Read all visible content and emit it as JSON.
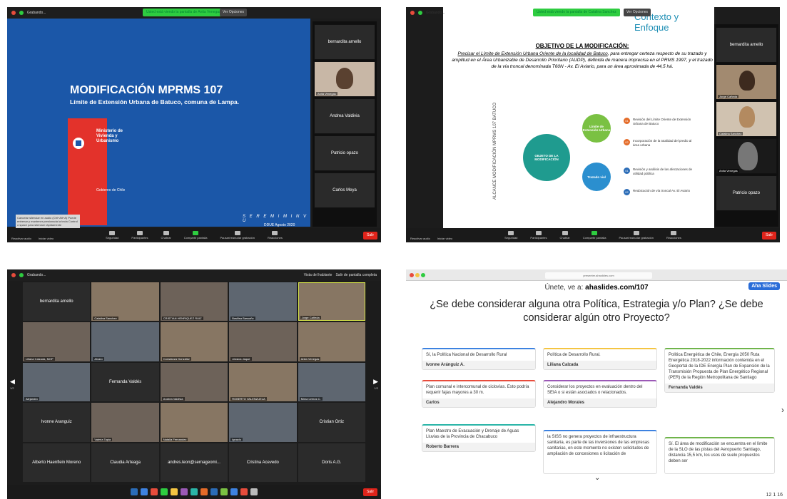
{
  "q1": {
    "recording": "Grabando...",
    "share_banner": "Usted está viendo la pantalla de Anita Venegas",
    "view_options": "Ver Opciones",
    "slide_title": "MODIFICACIÓN MPRMS 107",
    "slide_subtitle": "Límite de Extensión Urbana de Batuco, comuna de Lampa.",
    "ministry": "Ministerio de Vivienda y Urbanismo",
    "gobierno": "Gobierno de Chile",
    "seremi": "S E R E M I   M I N V U",
    "ddue": "DDUE Agosto 2020",
    "tooltip": "Cancelar silenciar en audio (Ctrl+Alt+A) Puede entrenar y mantener presionada la tecla Control o space para silenciar rápidamente",
    "participants": [
      "bernardita arnello",
      "Anita Venegas",
      "Andrea Valdivia",
      "Patricio opazo",
      "Carlos Meya"
    ],
    "url_tooltip": "https://asistente.ahaslides.com/",
    "bottom": [
      "Reactivar audio",
      "Iniciar video",
      "Seguridad",
      "Participantes",
      "Chatear",
      "Compartir pantalla",
      "Pausar/reanudar grabación",
      "Reacciones"
    ],
    "end": "Salir"
  },
  "q2": {
    "recording": "Grabando...",
    "share_banner": "Usted está viendo la pantalla de Catalina Sanchez",
    "view_options": "Ver Opciones",
    "ctx_title": "Contexto y Enfoque",
    "obj_heading": "OBJETIVO DE LA MODIFICACIÓN:",
    "obj_text_underlined": "Precisar el Límite de Extensión Urbana Oriente de la localidad de Batuco",
    "obj_text": ", para entregar certeza respecto de su trazado y amplitud en el Área Urbanizable de Desarrollo Prioritario (AUDP), definida de manera imprecisa en el PRMS 1997, y el trazado de la vía troncal denominada T60N - Av. El Aviario, para un área aproximada de 44,5 há.",
    "vertical_label": "ALCANCE MODIFICACIÓN MPRMS 107 BATUCO",
    "center": "OBJETO DE LA MODIFICACIÓN",
    "node_limit": "Límite de Extensión Urbana",
    "node_road": "Trazado vial",
    "items": [
      {
        "n": "01",
        "text": "Revisión del Límite Oriente de Extensión Urbana de Batuco"
      },
      {
        "n": "02",
        "text": "Incorporación de la totalidad del predio al área urbana"
      },
      {
        "n": "01",
        "text": "Revisión y análisis de las afectaciones de utilidad pública"
      },
      {
        "n": "02",
        "text": "Reubicación de vía troncal Av. El Aviario"
      }
    ],
    "participants": [
      "bernardita arnello",
      "Jorge Cañeda",
      "Catalina Sanchez",
      "Anita Venegas",
      "Patricio opazo"
    ],
    "end": "Salir"
  },
  "q3": {
    "recording": "Grabando...",
    "speaker_view": "Vista del hablante",
    "exit_full": "Salir de pantalla completa",
    "page_left": "1/2",
    "page_right": "1/2",
    "tiles": [
      {
        "label": "bernardita arnello",
        "video": false
      },
      {
        "label": "Catalina Sanchez",
        "video": true
      },
      {
        "label": "CRISTIAN HENRIQUEZ RUIZ",
        "video": true
      },
      {
        "label": "Basilisa Bassaño",
        "video": true
      },
      {
        "label": "Jorge Cañeda",
        "video": true
      },
      {
        "label": "Liliana Calzada, MOP",
        "video": true
      },
      {
        "label": "Alvaro",
        "video": true
      },
      {
        "label": "Constanza González",
        "video": true
      },
      {
        "label": "Jessica Jaque",
        "video": true
      },
      {
        "label": "Anita Venegas",
        "video": true
      },
      {
        "label": "Alejandro",
        "video": true
      },
      {
        "label": "Fernanda Valdés",
        "video": false
      },
      {
        "label": "Andrea Valdivia",
        "video": true
      },
      {
        "label": "ROBERTO VALENZUELA",
        "video": true
      },
      {
        "label": "Mirza Lemus C.",
        "video": true
      },
      {
        "label": "Ivonne Aranguiz",
        "video": false
      },
      {
        "label": "Valeria Tapia",
        "video": true
      },
      {
        "label": "Natalia Fernandez",
        "video": true
      },
      {
        "label": "Ignacio",
        "video": true
      },
      {
        "label": "Cristian Ortiz",
        "video": false
      },
      {
        "label": "Alberto Haenflein Moreno",
        "video": false
      },
      {
        "label": "Claudia Arteaga",
        "video": false
      },
      {
        "label": "andres.leon@sernageomi...",
        "video": false
      },
      {
        "label": "Cristina Acevedo",
        "video": false
      },
      {
        "label": "Doris A.G.",
        "video": false
      }
    ],
    "end": "Salir"
  },
  "q4": {
    "url": "presenter.ahaslides.com",
    "join_prefix": "Únete, ve a: ",
    "join_url": "ahaslides.com/107",
    "logo": "Aha Slides",
    "question": "¿Se debe considerar alguna otra Política, Estrategia y/o Plan? ¿Se debe considerar algún otro Proyecto?",
    "cards": [
      {
        "text": "Sí, la Política Nacional de Desarrollo Rural",
        "author": "Ivonne Aránguiz A."
      },
      {
        "text": "Política de Desarrollo Rural.",
        "author": "Liliana Calzada"
      },
      {
        "text": "Política Energética de Chile, Energía 2050 Ruta Energética 2018-2022 información contenida en el Geoportal de la IDE Energía Plan de Expansión de la Transmisión Propuesta de Plan Energético Regional (PER) de la Región Metropolitana de Santiago",
        "author": "Fernanda Valdés"
      },
      {
        "text": "Plan comunal e intercomunal de ciclovías. Esto podría requerir fajas mayores a 30 m.",
        "author": "Carlos"
      },
      {
        "text": "Considerar los proyectos en evaluación dentro del SEIA o si están asociados o relacionados.",
        "author": "Alejandro Morales"
      },
      {
        "text": "Plan Maestro de Evacuación y Drenaje de Aguas Lluvias de la Provincia de Chacabuco",
        "author": "Roberto Barrera"
      },
      {
        "text": "la SISS no genera proyectos de infraestructura sanitaria, es parte de las inversiones de las empresas sanitarias, en este momento no existen solicitudes de ampliación de concesiones o licitación de",
        "author": ""
      },
      {
        "text": "Sí. El área de modificación se encuentra en el límite de la SLO de las pistas del Aeropuerto Santiago, distancia 15,5 km, los usos de suelo propuestos deben ser",
        "author": ""
      }
    ],
    "stats": "12  1  16"
  }
}
